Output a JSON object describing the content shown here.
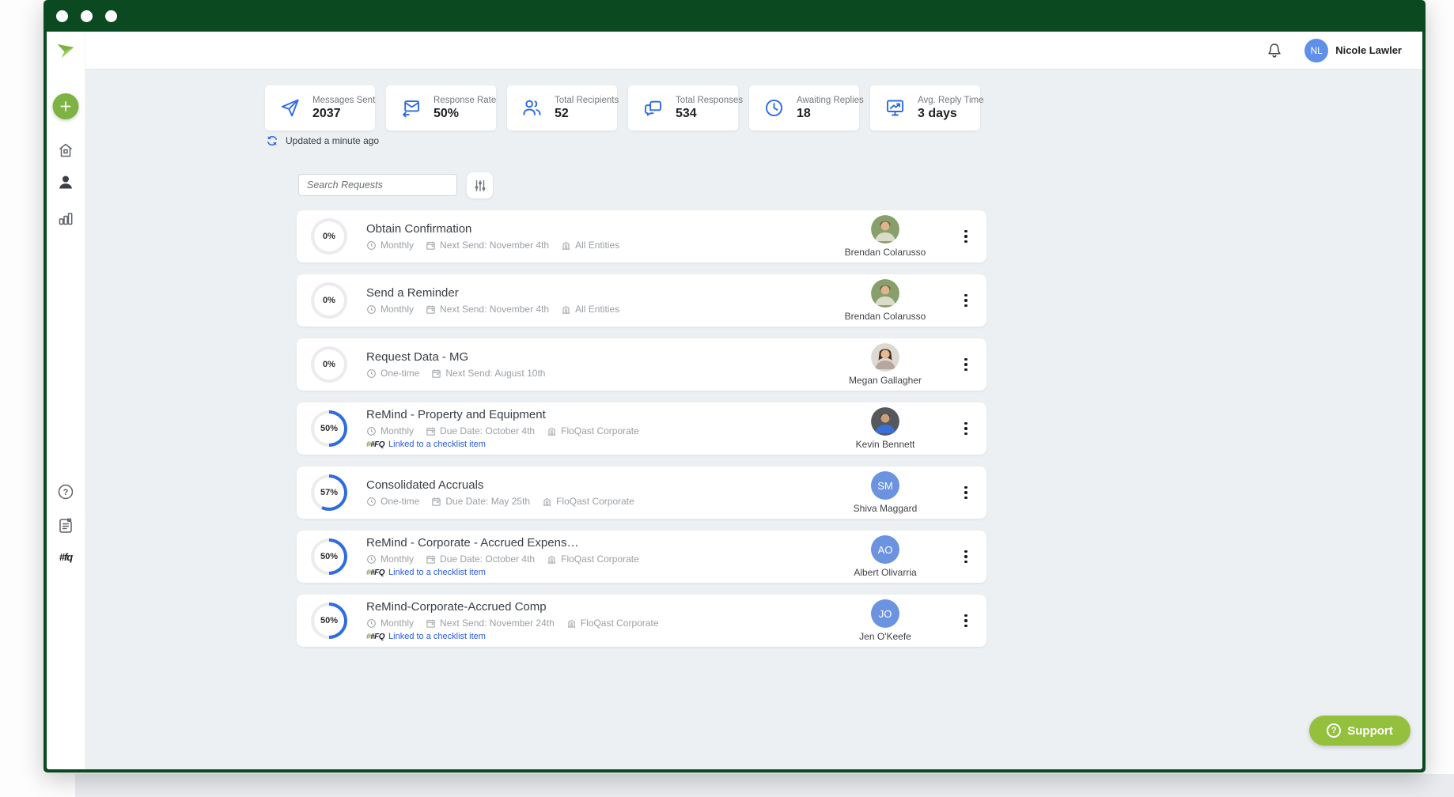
{
  "colors": {
    "frame_green": "#0b4a20",
    "accent_green": "#7cb342",
    "support_green": "#94c13d",
    "icon_blue": "#2e6be6",
    "progress_blue": "#2f6ce0",
    "linked_blue": "#2a5bd7",
    "avatar_blue": "#6b93e0",
    "content_bg": "#edf0f3"
  },
  "topbar": {
    "user_name": "Nicole Lawler",
    "user_initials": "NL",
    "bell_icon": "notification-bell"
  },
  "sidebar": {
    "logo_icon": "floqast-remind-logo",
    "new_request_icon": "plus",
    "items": [
      {
        "icon": "home"
      },
      {
        "icon": "person"
      },
      {
        "icon": "bar-chart"
      }
    ],
    "footer_items": [
      {
        "icon": "help-circle"
      },
      {
        "icon": "scroll-document"
      },
      {
        "icon": "floqast-hash-logo",
        "label": "#fq"
      }
    ]
  },
  "stats": {
    "updated_text": "Updated a minute ago",
    "cards": [
      {
        "icon": "paper-plane",
        "label": "Messages Sent",
        "value": "2037"
      },
      {
        "icon": "mail-reply",
        "label": "Response Rate",
        "value": "50%"
      },
      {
        "icon": "people",
        "label": "Total Recipients",
        "value": "52"
      },
      {
        "icon": "chat-bubbles",
        "label": "Total Responses",
        "value": "534"
      },
      {
        "icon": "clock",
        "label": "Awaiting Replies",
        "value": "18"
      },
      {
        "icon": "monitor-trend",
        "label": "Avg. Reply Time",
        "value": "3 days"
      }
    ]
  },
  "search": {
    "placeholder": "Search Requests",
    "filter_icon": "sliders"
  },
  "requests": [
    {
      "pct": 0,
      "progress": "0%",
      "title": "Obtain Confirmation",
      "frequency": "Monthly",
      "schedule": "Next Send: November 4th",
      "entity": "All Entities",
      "owner": "Brendan Colarusso"
    },
    {
      "pct": 0,
      "progress": "0%",
      "title": "Send a Reminder",
      "frequency": "Monthly",
      "schedule": "Next Send: November 4th",
      "entity": "All Entities",
      "owner": "Brendan Colarusso"
    },
    {
      "pct": 0,
      "progress": "0%",
      "title": "Request Data - MG",
      "frequency": "One-time",
      "schedule": "Next Send: August 10th",
      "owner": "Megan Gallagher"
    },
    {
      "pct": 50,
      "progress": "50%",
      "title": "ReMind - Property and Equipment",
      "frequency": "Monthly",
      "schedule": "Due Date: October 4th",
      "entity": "FloQast Corporate",
      "linked_icon_label": "#FQ",
      "linked_label": "Linked to a checklist item",
      "owner": "Kevin Bennett"
    },
    {
      "pct": 57,
      "progress": "57%",
      "title": "Consolidated Accruals",
      "frequency": "One-time",
      "schedule": "Due Date: May 25th",
      "entity": "FloQast Corporate",
      "owner": "Shiva Maggard",
      "initials": "SM"
    },
    {
      "pct": 50,
      "progress": "50%",
      "title": "ReMind - Corporate - Accrued Expens…",
      "frequency": "Monthly",
      "schedule": "Due Date: October 4th",
      "entity": "FloQast Corporate",
      "linked_icon_label": "#FQ",
      "linked_label": "Linked to a checklist item",
      "owner": "Albert Olivarria",
      "initials": "AO"
    },
    {
      "pct": 50,
      "progress": "50%",
      "title": "ReMind-Corporate-Accrued Comp",
      "frequency": "Monthly",
      "schedule": "Next Send: November 24th",
      "entity": "FloQast Corporate",
      "linked_icon_label": "#FQ",
      "linked_label": "Linked to a checklist item",
      "owner": "Jen O'Keefe",
      "initials": "JO"
    }
  ],
  "support": {
    "label": "Support"
  }
}
